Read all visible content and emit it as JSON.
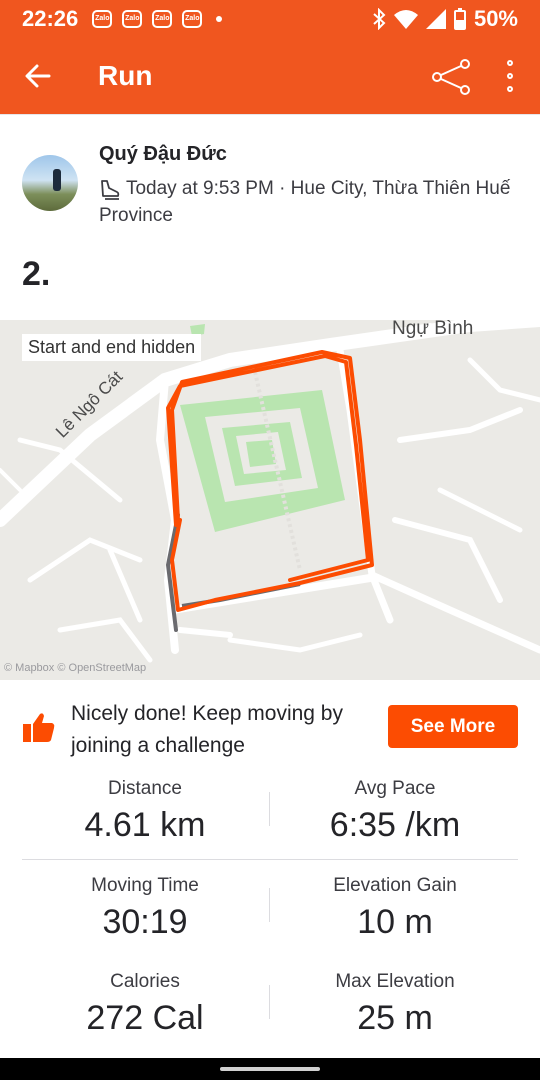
{
  "status_bar": {
    "time": "22:26",
    "notification_icons": [
      "Zalo",
      "Zalo",
      "Zalo",
      "Zalo"
    ],
    "battery": "50%"
  },
  "app_bar": {
    "title": "Run",
    "back_icon": "arrow-left",
    "share_icon": "share",
    "more_icon": "more-vertical"
  },
  "activity": {
    "athlete_name": "Quý Đậu Đức",
    "meta": "Today at 9:53 PM · Hue City, Thừa Thiên Huế Province",
    "name": "2."
  },
  "map": {
    "chip": "Start and end hidden",
    "attribution": "© Mapbox © OpenStreetMap",
    "streets": [
      "Ngự Bình",
      "Lê Ngô Cát"
    ],
    "route_color": "#fc4c02"
  },
  "challenge": {
    "text": "Nicely done! Keep moving by joining a challenge",
    "button": "See More"
  },
  "stats": [
    {
      "label": "Distance",
      "value": "4.61 km"
    },
    {
      "label": "Avg Pace",
      "value": "6:35 /km"
    },
    {
      "label": "Moving Time",
      "value": "30:19"
    },
    {
      "label": "Elevation Gain",
      "value": "10 m"
    },
    {
      "label": "Calories",
      "value": "272 Cal"
    },
    {
      "label": "Max Elevation",
      "value": "25 m"
    }
  ],
  "colors": {
    "brand": "#fc4c02",
    "appbar": "#f0561f"
  }
}
